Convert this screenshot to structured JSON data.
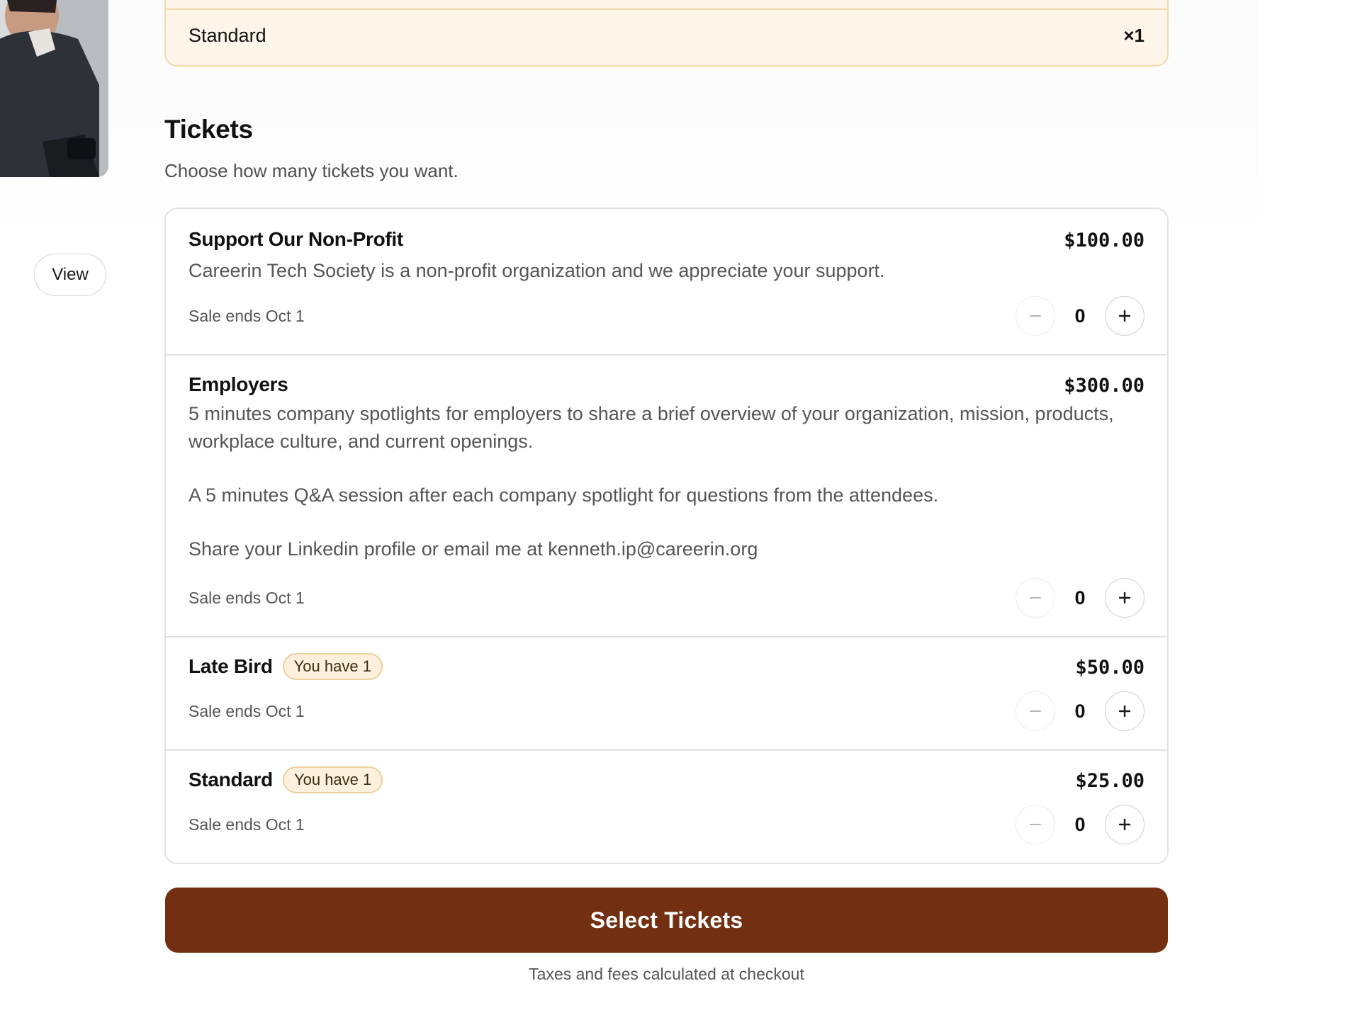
{
  "left_panel": {
    "view_label": "View"
  },
  "summary": {
    "items": [
      {
        "name": "Standard",
        "quantity": "×1"
      }
    ]
  },
  "tickets_section": {
    "title": "Tickets",
    "subtitle": "Choose how many tickets you want."
  },
  "tickets": [
    {
      "name": "Support Our Non-Profit",
      "badge": "",
      "price": "$100.00",
      "description": [
        "Careerin Tech Society is a non-profit organization and we appreciate your support."
      ],
      "sale_ends": "Sale ends Oct 1",
      "quantity": "0"
    },
    {
      "name": "Employers",
      "badge": "",
      "price": "$300.00",
      "description": [
        "5 minutes company spotlights for employers to share a brief overview of your organization, mission, products, workplace culture, and current openings.",
        "A 5 minutes Q&A session after each company spotlight for questions from the attendees.",
        "Share your Linkedin profile or email me at kenneth.ip@careerin.org"
      ],
      "sale_ends": "Sale ends Oct 1",
      "quantity": "0"
    },
    {
      "name": "Late Bird",
      "badge": "You have 1",
      "price": "$50.00",
      "description": [],
      "sale_ends": "Sale ends Oct 1",
      "quantity": "0"
    },
    {
      "name": "Standard",
      "badge": "You have 1",
      "price": "$25.00",
      "description": [],
      "sale_ends": "Sale ends Oct 1",
      "quantity": "0"
    }
  ],
  "actions": {
    "select_label": "Select Tickets",
    "footnote": "Taxes and fees calculated at checkout"
  },
  "colors": {
    "primary_button": "#732f12",
    "summary_background": "#fef5e9",
    "summary_border": "#f0d9b0",
    "badge_background": "#fdf1de",
    "badge_border": "#ecd19d"
  },
  "icons": {
    "decrement": "minus-icon",
    "increment": "plus-icon"
  }
}
